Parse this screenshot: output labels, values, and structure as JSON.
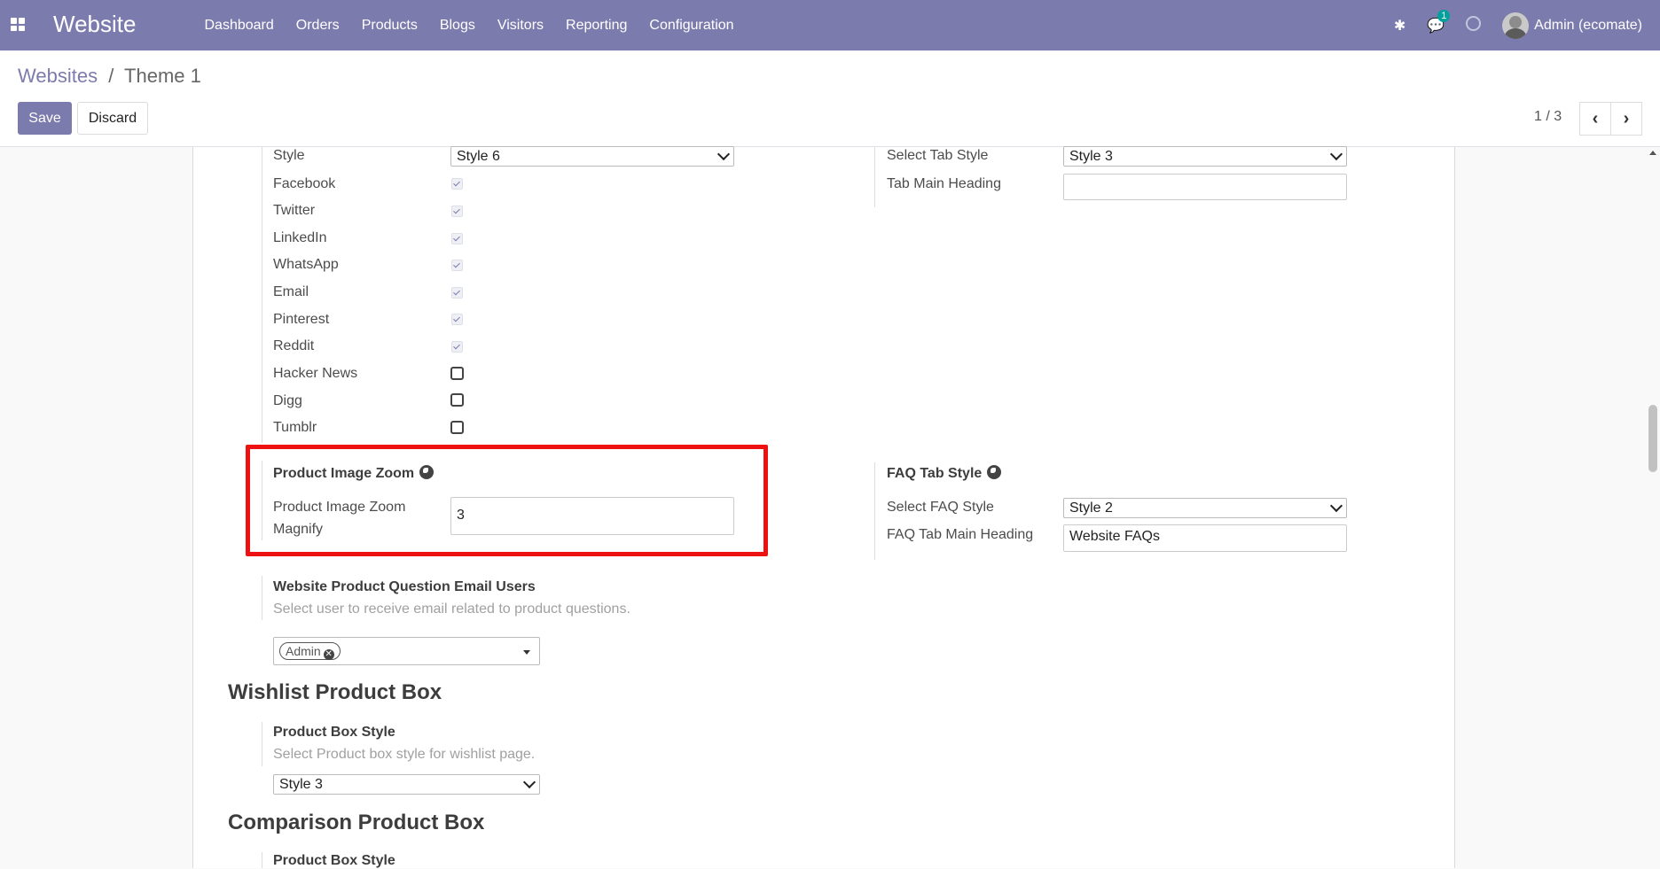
{
  "navbar": {
    "app_name": "Website",
    "menu": [
      "Dashboard",
      "Orders",
      "Products",
      "Blogs",
      "Visitors",
      "Reporting",
      "Configuration"
    ],
    "messages_badge": "1",
    "user": "Admin (ecomate)",
    "bg_color": "#7c7bad"
  },
  "breadcrumb": {
    "parent": "Websites",
    "separator": "/",
    "current": "Theme 1"
  },
  "buttons": {
    "save": "Save",
    "discard": "Discard"
  },
  "pager": {
    "value": "1 / 3"
  },
  "social": {
    "style_label": "Style",
    "style_value": "Style 6",
    "items": [
      {
        "label": "Facebook",
        "checked": true
      },
      {
        "label": "Twitter",
        "checked": true
      },
      {
        "label": "LinkedIn",
        "checked": true
      },
      {
        "label": "WhatsApp",
        "checked": true
      },
      {
        "label": "Email",
        "checked": true
      },
      {
        "label": "Pinterest",
        "checked": true
      },
      {
        "label": "Reddit",
        "checked": true
      },
      {
        "label": "Hacker News",
        "checked": false
      },
      {
        "label": "Digg",
        "checked": false
      },
      {
        "label": "Tumblr",
        "checked": false
      }
    ]
  },
  "tab": {
    "select_label": "Select Tab Style",
    "select_value": "Style 3",
    "heading_label": "Tab Main Heading",
    "heading_value": ""
  },
  "zoom": {
    "title": "Product Image Zoom",
    "magnify_label_1": "Product Image Zoom",
    "magnify_label_2": "Magnify",
    "magnify_value": "3"
  },
  "faq": {
    "title": "FAQ Tab Style",
    "select_label": "Select FAQ Style",
    "select_value": "Style 2",
    "heading_label": "FAQ Tab Main Heading",
    "heading_value": "Website FAQs"
  },
  "question_users": {
    "title": "Website Product Question Email Users",
    "help": "Select user to receive email related to product questions.",
    "tag": "Admin"
  },
  "wishlist": {
    "heading": "Wishlist Product Box",
    "field_label": "Product Box Style",
    "help": "Select Product box style for wishlist page.",
    "value": "Style 3"
  },
  "comparison": {
    "heading": "Comparison Product Box",
    "field_label": "Product Box Style"
  }
}
